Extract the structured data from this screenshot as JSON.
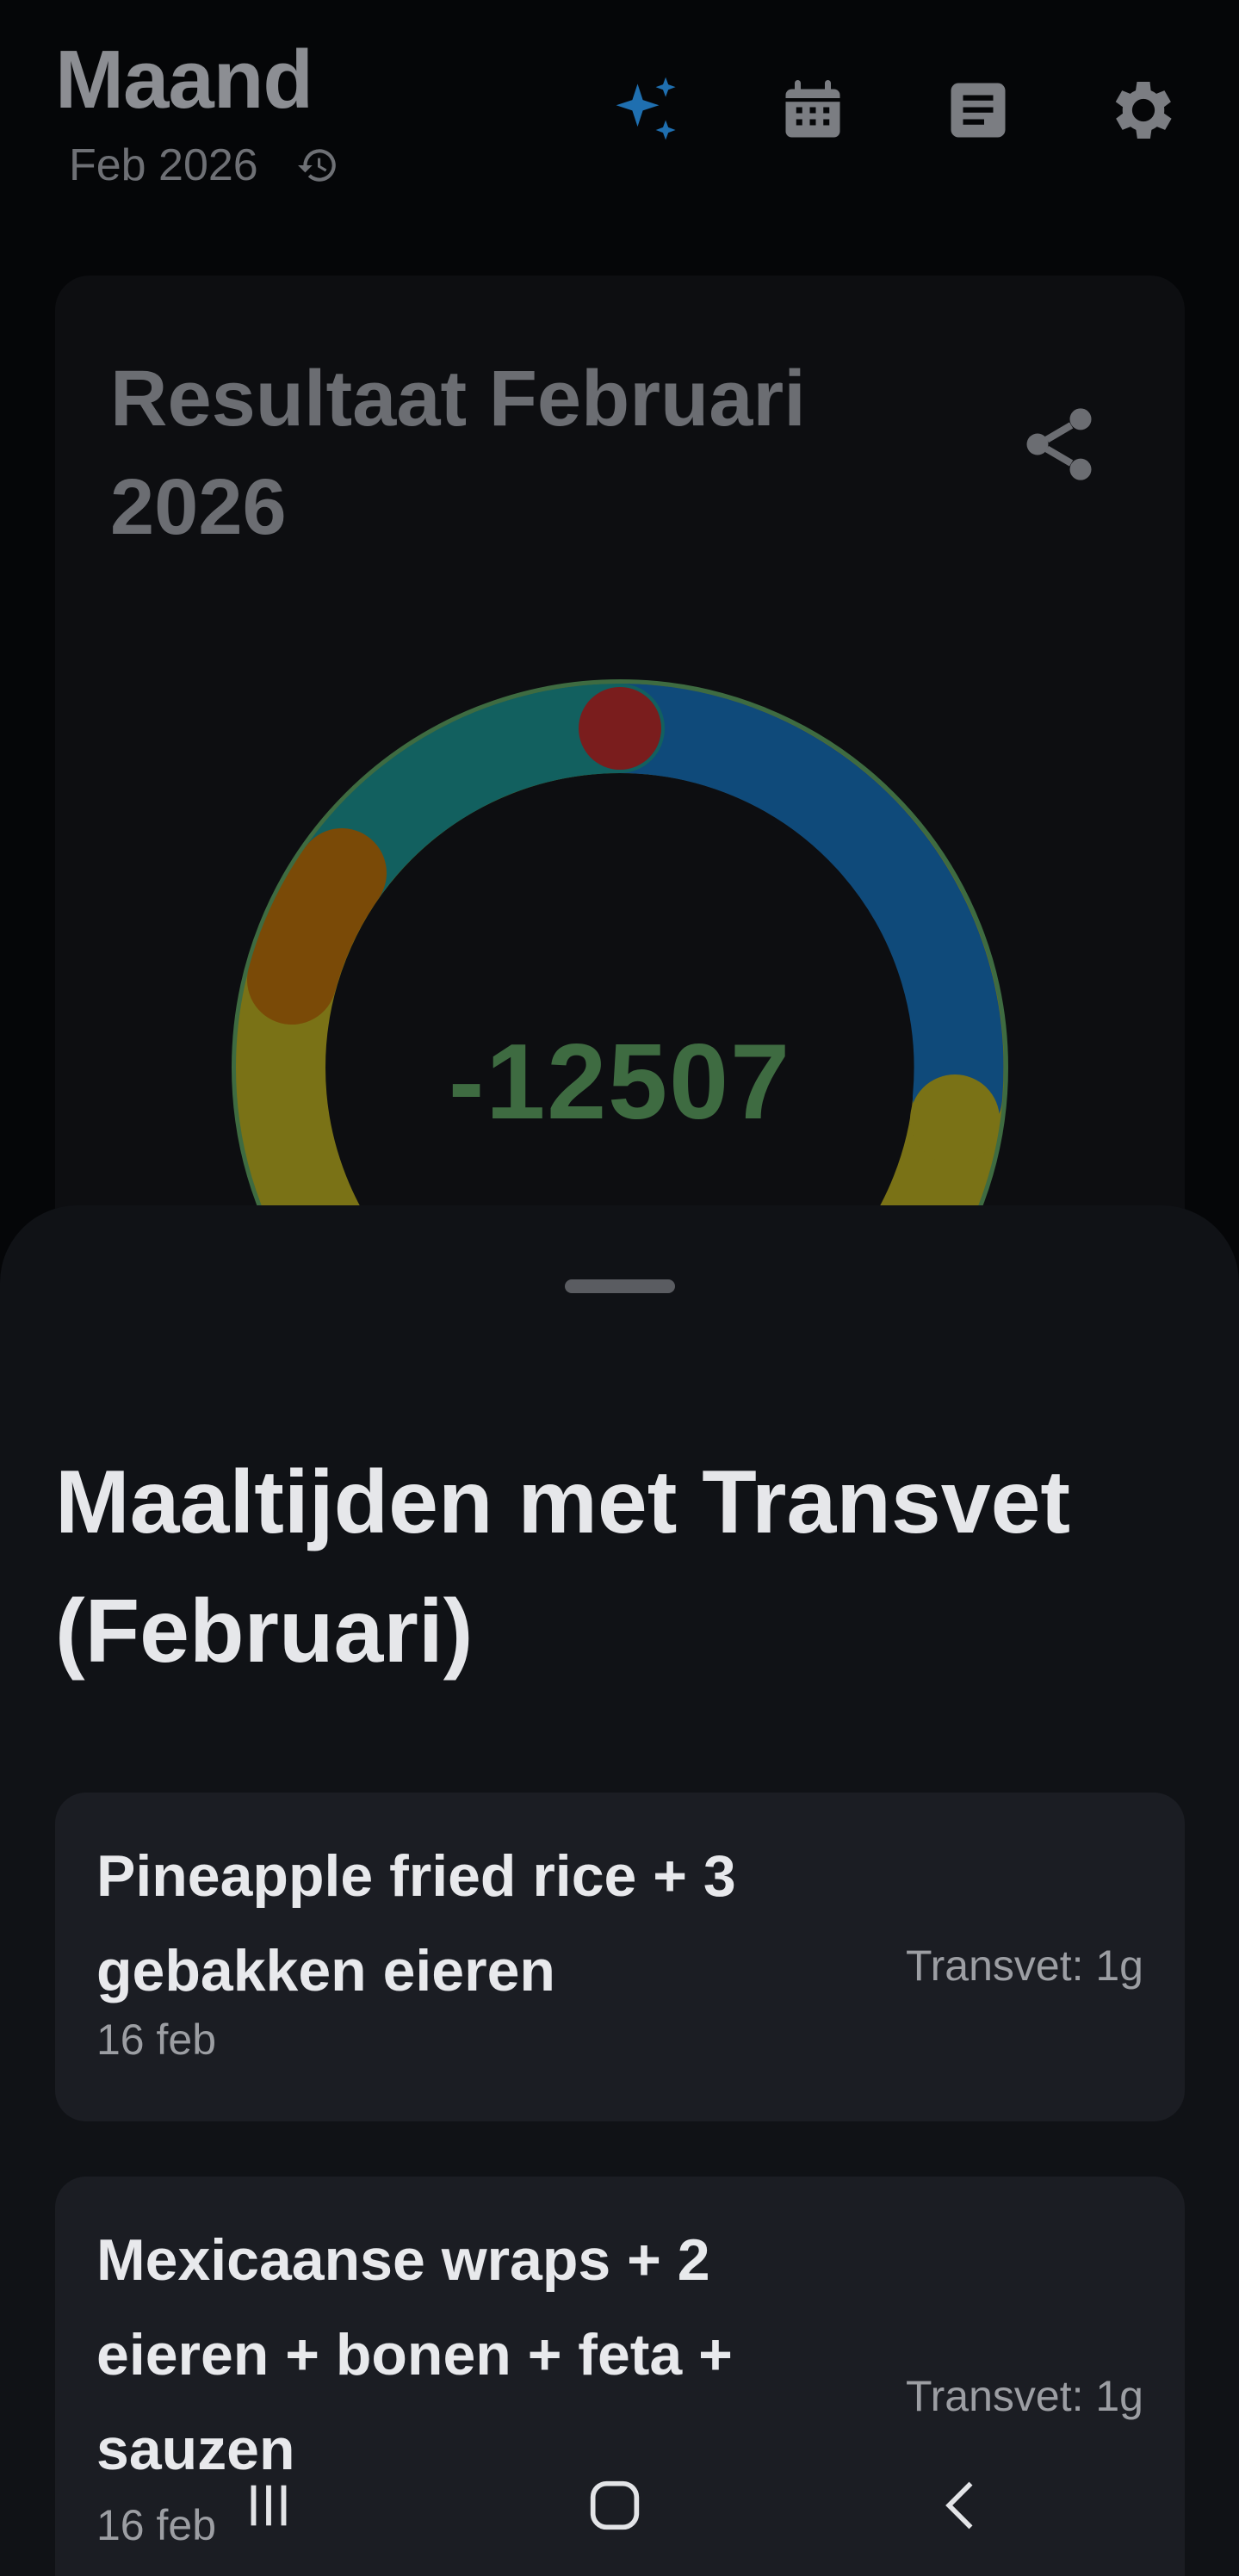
{
  "header": {
    "title": "Maand",
    "month": "Feb 2026"
  },
  "icons": {
    "ai": "sparkle-icon",
    "calendar": "calendar-icon",
    "notes": "notes-icon",
    "settings": "gear-icon",
    "history": "history-icon",
    "share": "share-icon"
  },
  "colors": {
    "accent_blue": "#1f6fb0",
    "ring_green": "#3e6b41",
    "segment_blue": "#0f4a7a",
    "segment_teal": "#12605f",
    "segment_orange": "#7a4a07",
    "segment_olive": "#7a7216",
    "segment_red": "#7a1d1d"
  },
  "card": {
    "title": "Resultaat Februari 2026",
    "value": "-12507"
  },
  "sheet": {
    "title": "Maaltijden met Transvet (Februari)",
    "meals": [
      {
        "name": "Pineapple fried rice + 3 gebakken eieren",
        "date": "16 feb",
        "trans": "Transvet: 1g"
      },
      {
        "name": "Mexicaanse wraps + 2 eieren + bonen + feta + sauzen",
        "date": "16 feb",
        "trans": "Transvet: 1g"
      }
    ]
  },
  "navbar": {
    "recent": "recent-apps-icon",
    "home": "home-icon",
    "back": "back-icon"
  }
}
